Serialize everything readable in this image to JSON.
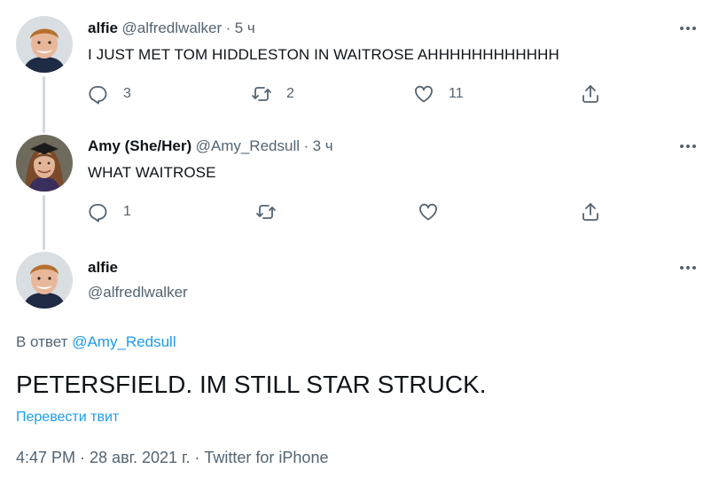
{
  "tweets": [
    {
      "name": "alfie",
      "handle": "@alfredlwalker",
      "sep": "·",
      "time": "5 ч",
      "text": "I JUST MET TOM HIDDLESTON IN WAITROSE AHHHHHHHHHHHH",
      "replies": "3",
      "retweets": "2",
      "likes": "11"
    },
    {
      "name": "Amy (She/Her)",
      "handle": "@Amy_Redsull",
      "sep": "·",
      "time": "3 ч",
      "text": "WHAT WAITROSE",
      "replies": "1",
      "retweets": "",
      "likes": ""
    }
  ],
  "main": {
    "name": "alfie",
    "handle": "@alfredlwalker",
    "reply_prefix": "В ответ",
    "reply_to": "@Amy_Redsull",
    "text": "PETERSFIELD. IM STILL STAR STRUCK.",
    "translate": "Перевести твит",
    "meta": "4:47 PM · 28 авг. 2021 г. · Twitter for iPhone"
  },
  "colors": {
    "accent": "#1d9bf0",
    "text": "#0f1419",
    "muted": "#536471",
    "line": "#cfd9de"
  },
  "icons": [
    "reply-icon",
    "retweet-icon",
    "like-icon",
    "share-icon",
    "more-icon"
  ]
}
